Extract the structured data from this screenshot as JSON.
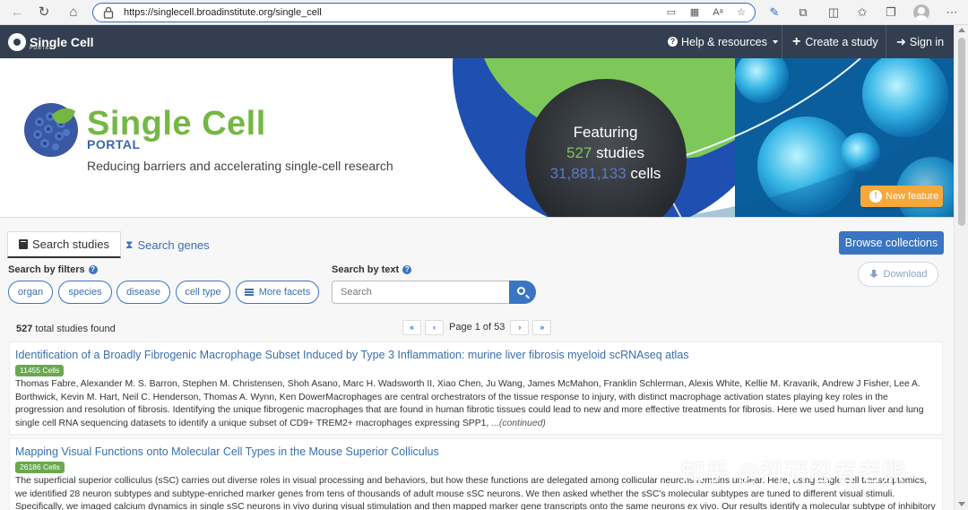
{
  "browser": {
    "url": "https://singlecell.broadinstitute.org/single_cell"
  },
  "navbar": {
    "brand": "Single Cell",
    "brand_sub": "PORTAL",
    "help": "Help & resources",
    "create": "Create a study",
    "signin": "Sign in"
  },
  "hero": {
    "title": "Single Cell",
    "portal": "PORTAL",
    "tagline": "Reducing barriers and accelerating single-cell research",
    "featuring": "Featuring",
    "study_count": "527",
    "studies_label": "studies",
    "cell_count": "31,881,133",
    "cells_label": "cells",
    "new_feature": "New feature"
  },
  "tabs": {
    "studies": "Search studies",
    "genes": "Search genes"
  },
  "buttons": {
    "collections": "Browse collections",
    "download": "Download"
  },
  "filters": {
    "label": "Search by filters",
    "items": [
      "organ",
      "species",
      "disease",
      "cell type"
    ],
    "more": "More facets"
  },
  "text_search": {
    "label": "Search by text",
    "placeholder": "Search"
  },
  "results": {
    "total": "527",
    "total_label": "total studies found",
    "page_text": "Page 1 of 53"
  },
  "studies": [
    {
      "title": "Identification of a Broadly Fibrogenic Macrophage Subset Induced by Type 3 Inflammation: murine liver fibrosis myeloid scRNAseq atlas",
      "cells": "11455 Cells",
      "description": "Thomas Fabre, Alexander M. S. Barron, Stephen M. Christensen, Shoh Asano, Marc H. Wadsworth II, Xiao Chen, Ju Wang, James McMahon, Franklin Schlerman, Alexis White, Kellie M. Kravarik, Andrew J Fisher, Lee A. Borthwick, Kevin M. Hart, Neil C. Henderson, Thomas A. Wynn, Ken DowerMacrophages are central orchestrators of the tissue response to injury, with distinct macrophage activation states playing key roles in the progression and resolution of fibrosis. Identifying the unique fibrogenic macrophages that are found in human fibrotic tissues could lead to new and more effective treatments for fibrosis. Here we used human liver and lung single cell RNA sequencing datasets to identify a unique subset of CD9+ TREM2+ macrophages expressing SPP1, ",
      "continued": "...(continued)"
    },
    {
      "title": "Mapping Visual Functions onto Molecular Cell Types in the Mouse Superior Colliculus",
      "cells": "26186 Cells",
      "description": "The superficial superior colliculus (sSC) carries out diverse roles in visual processing and behaviors, but how these functions are delegated among collicular neurons remains unclear. Here, using single-cell transcriptomics, we identified 28 neuron subtypes and subtype-enriched marker genes from tens of thousands of adult mouse sSC neurons. We then asked whether the sSC's molecular subtypes are tuned to different visual stimuli. Specifically, we imaged calcium dynamics in single sSC neurons in vivo during visual stimulation and then mapped marker gene transcripts onto the same neurons ex vivo. Our results identify a molecular subtype of inhibitory neuron accounting",
      "continued": ""
    }
  ],
  "watermark": "知乎 @科研忍者老熊",
  "colors": {
    "navbar": "#333f50",
    "accent": "#3a75c4",
    "brand_green": "#75b743",
    "badge_green": "#6aa84f",
    "new_feature": "#f7a83a"
  }
}
